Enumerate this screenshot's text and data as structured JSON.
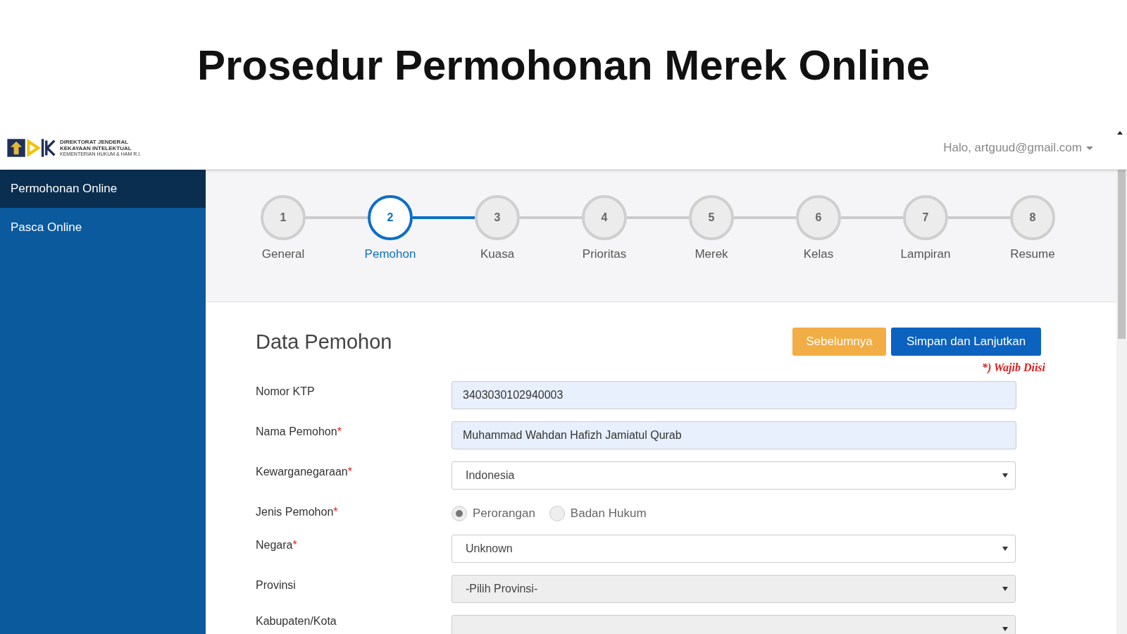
{
  "slide_title": "Prosedur Permohonan Merek Online",
  "header": {
    "logo_lines": [
      "DIREKTORAT JENDERAL",
      "KEKAYAAN INTELEKTUAL",
      "KEMENTERIAN HUKUM & HAM R.I."
    ],
    "user_menu": "Halo, artguud@gmail.com"
  },
  "sidebar": {
    "items": [
      {
        "label": "Permohonan Online",
        "selected": true
      },
      {
        "label": "Pasca Online",
        "selected": false
      }
    ]
  },
  "steps": [
    {
      "number": "1",
      "label": "General",
      "selected": false
    },
    {
      "number": "2",
      "label": "Pemohon",
      "selected": true
    },
    {
      "number": "3",
      "label": "Kuasa",
      "selected": false
    },
    {
      "number": "4",
      "label": "Prioritas",
      "selected": false
    },
    {
      "number": "5",
      "label": "Merek",
      "selected": false
    },
    {
      "number": "6",
      "label": "Kelas",
      "selected": false
    },
    {
      "number": "7",
      "label": "Lampiran",
      "selected": false
    },
    {
      "number": "8",
      "label": "Resume",
      "selected": false
    }
  ],
  "form": {
    "title": "Data Pemohon",
    "buttons": [
      {
        "label": "Sebelumnya",
        "kind": "secondary"
      },
      {
        "label": "Simpan dan Lanjutkan",
        "kind": "primary"
      }
    ],
    "required_note": "*) Wajib Diisi",
    "fields": [
      {
        "label": "Nomor KTP",
        "kind": "text",
        "value": "3403030102940003",
        "autofilled": true
      },
      {
        "label": "Nama Pemohon",
        "required_mark": "*",
        "kind": "text",
        "value": "Muhammad Wahdan Hafizh Jamiatul Qurab",
        "autofilled": true
      },
      {
        "label": "Kewarganegaraan",
        "required_mark": "*",
        "kind": "select",
        "value": "Indonesia",
        "disabled": false
      },
      {
        "label": "Jenis Pemohon",
        "required_mark": "*",
        "kind": "radio",
        "options": [
          {
            "label": "Perorangan",
            "selected": true
          },
          {
            "label": "Badan Hukum",
            "selected": false
          }
        ]
      },
      {
        "label": "Negara",
        "required_mark": "*",
        "kind": "select",
        "value": "Unknown",
        "disabled": false
      },
      {
        "label": "Provinsi",
        "kind": "select",
        "value": "-Pilih Provinsi-",
        "disabled": true
      },
      {
        "label": "Kabupaten/Kota",
        "kind": "select",
        "disabled": true
      }
    ]
  }
}
